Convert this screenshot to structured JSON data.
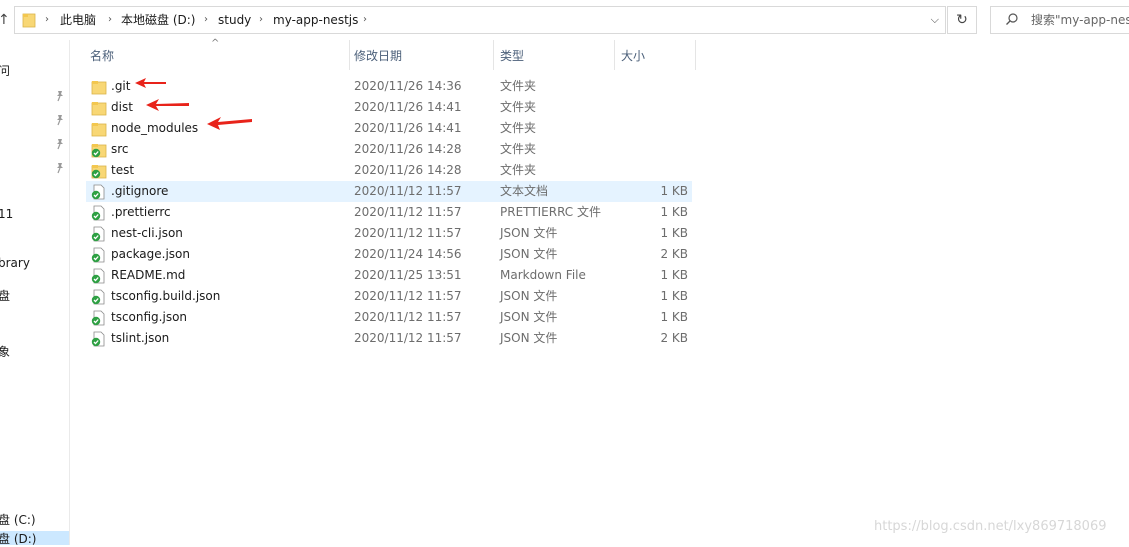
{
  "address_bar": {
    "breadcrumbs": [
      "此电脑",
      "本地磁盘 (D:)",
      "study",
      "my-app-nestjs"
    ]
  },
  "search": {
    "text": "搜索\"my-app-nes"
  },
  "nav_pane": {
    "items": [
      {
        "label": "问"
      },
      {
        "label": "11"
      },
      {
        "label": "brary"
      },
      {
        "label": "盘"
      },
      {
        "label": "象"
      },
      {
        "label": "盘 (C:)"
      },
      {
        "label": "盘 (D:)"
      }
    ]
  },
  "columns": [
    "名称",
    "修改日期",
    "类型",
    "大小"
  ],
  "files": [
    {
      "name": ".git",
      "date": "2020/11/26 14:36",
      "type": "文件夹",
      "size": "",
      "icon": "folder-icon"
    },
    {
      "name": "dist",
      "date": "2020/11/26 14:41",
      "type": "文件夹",
      "size": "",
      "icon": "folder-icon"
    },
    {
      "name": "node_modules",
      "date": "2020/11/26 14:41",
      "type": "文件夹",
      "size": "",
      "icon": "folder-icon"
    },
    {
      "name": "src",
      "date": "2020/11/26 14:28",
      "type": "文件夹",
      "size": "",
      "icon": "folder-synced-icon"
    },
    {
      "name": "test",
      "date": "2020/11/26 14:28",
      "type": "文件夹",
      "size": "",
      "icon": "folder-synced-icon"
    },
    {
      "name": ".gitignore",
      "date": "2020/11/12 11:57",
      "type": "文本文档",
      "size": "1 KB",
      "icon": "file-synced-icon"
    },
    {
      "name": ".prettierrc",
      "date": "2020/11/12 11:57",
      "type": "PRETTIERRC 文件",
      "size": "1 KB",
      "icon": "file-synced-icon"
    },
    {
      "name": "nest-cli.json",
      "date": "2020/11/12 11:57",
      "type": "JSON 文件",
      "size": "1 KB",
      "icon": "file-synced-icon"
    },
    {
      "name": "package.json",
      "date": "2020/11/24 14:56",
      "type": "JSON 文件",
      "size": "2 KB",
      "icon": "file-synced-icon"
    },
    {
      "name": "README.md",
      "date": "2020/11/25 13:51",
      "type": "Markdown File",
      "size": "1 KB",
      "icon": "file-synced-icon"
    },
    {
      "name": "tsconfig.build.json",
      "date": "2020/11/12 11:57",
      "type": "JSON 文件",
      "size": "1 KB",
      "icon": "file-synced-icon"
    },
    {
      "name": "tsconfig.json",
      "date": "2020/11/12 11:57",
      "type": "JSON 文件",
      "size": "1 KB",
      "icon": "file-synced-icon"
    },
    {
      "name": "tslint.json",
      "date": "2020/11/12 11:57",
      "type": "JSON 文件",
      "size": "2 KB",
      "icon": "file-synced-icon"
    }
  ],
  "selected_file": ".gitignore",
  "colors": {
    "selection": "#e5f3ff",
    "arrow": "#e8231a",
    "folder": "#f8d775",
    "sync_ok": "#2ea043"
  },
  "watermark": "https://blog.csdn.net/lxy869718069"
}
